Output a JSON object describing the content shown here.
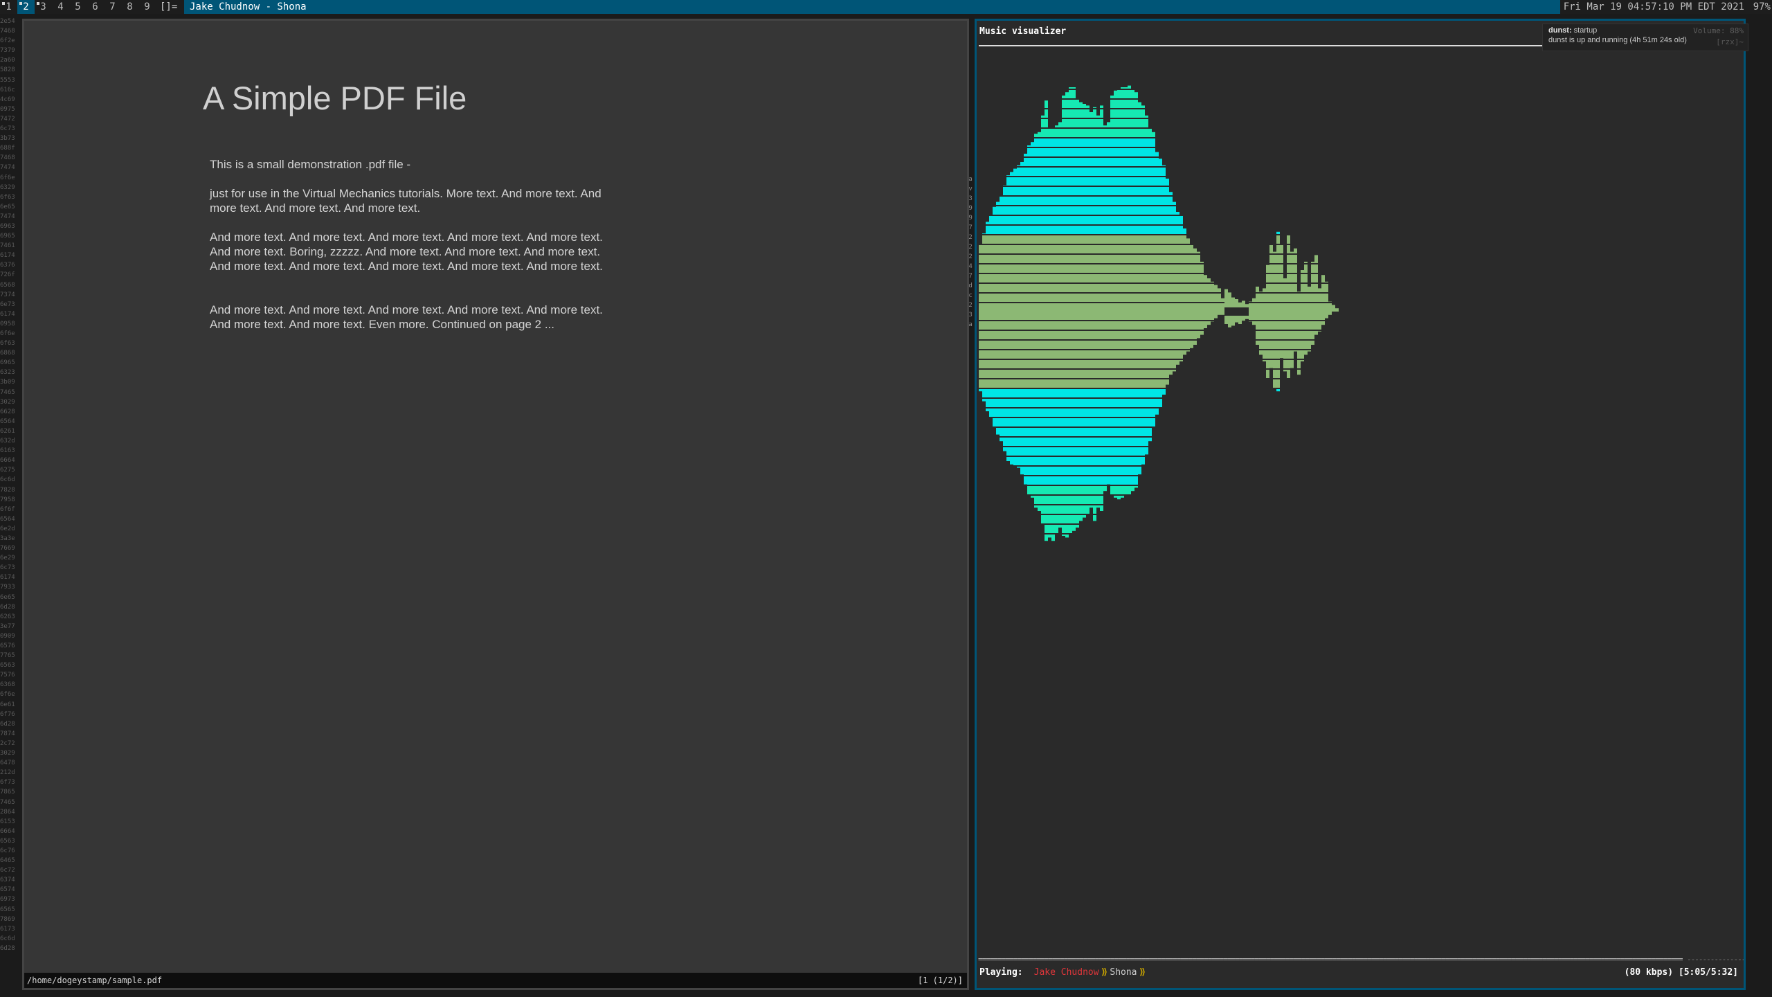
{
  "bar": {
    "tags": [
      "1",
      "2",
      "3",
      "4",
      "5",
      "6",
      "7",
      "8",
      "9"
    ],
    "active_tag": "2",
    "layout_symbol": "[]=",
    "window_title": "Jake Chudnow - Shona",
    "datetime": "Fri Mar 19 04:57:10 PM EDT 2021",
    "battery": "97%"
  },
  "background_terminal": {
    "hex_lines": [
      "2e54",
      "7468",
      "6f2e",
      "7379",
      "2a60",
      "5828",
      "5553",
      "616c",
      "4c69",
      "0975",
      "7472",
      "6c73",
      "3b73",
      "688f",
      "7468",
      "7474",
      "6f6e",
      "6329",
      "6f63",
      "6e65",
      "7474",
      "6963",
      "6965",
      "7461",
      "6174",
      "6376",
      "726f",
      "6568",
      "7374",
      "6e73",
      "6174",
      "0958",
      "6f6e",
      "6f63",
      "6868",
      "6965",
      "6323",
      "3b09",
      "7465",
      "3029",
      "6628",
      "6564",
      "6261",
      "632d",
      "6163",
      "6664",
      "6275",
      "6c6d",
      "7828",
      "7958",
      "6f6f",
      "6564",
      "6e2d",
      "3a3e",
      "7669",
      "6e29",
      "6c73",
      "6174",
      "7933",
      "6e65",
      "6d28",
      "6263",
      "3e77",
      "0909",
      "6576",
      "7765",
      "6563",
      "7576",
      "6368",
      "6f6e",
      "6e61",
      "6f76",
      "6d28",
      "7874",
      "2c72",
      "3029",
      "6478",
      "212d",
      "6f73",
      "7865",
      "7465",
      "2864",
      "6153",
      "6664",
      "6563",
      "6c76",
      "6465",
      "6c72",
      "6374",
      "6574",
      "6973",
      "6565",
      "7869",
      "6173",
      "6c6d",
      "6d28"
    ],
    "mid_glyphs": [
      ":a",
      ":v",
      ":3",
      ":9",
      ":9",
      ":7",
      ":2",
      ":2",
      ":2",
      ":4",
      ":7",
      ":d",
      ":c",
      ":2",
      ":3",
      ":a"
    ]
  },
  "pdf_viewer": {
    "title": "A Simple PDF File",
    "paragraphs": [
      "This is a small demonstration .pdf file -",
      "just for use in the Virtual Mechanics tutorials. More text. And more text. And more text. And more text. And more text.",
      "And more text. And more text. And more text. And more text. And more text. And more text. Boring, zzzzz. And more text. And more text. And more text. And more text. And more text. And more text. And more text. And more text.",
      "And more text. And more text. And more text. And more text. And more text. And more text. And more text. Even more. Continued on page 2 ..."
    ],
    "status_path": "/home/dogeystamp/sample.pdf",
    "status_page": "[1 (1/2)]"
  },
  "visualizer": {
    "title": "Music visualizer",
    "playing_label": "Playing:",
    "artist": "Jake Chudnow",
    "separator": "⟫",
    "track": "Shona",
    "bitrate": "(80 kbps)",
    "time": "[5:05/5:32]",
    "progress_fraction": 0.92,
    "colors": {
      "cyan": "#00e5e5",
      "teal": "#16e9b3",
      "green": "#8cb874",
      "accent_red": "#e0363a",
      "separator": "#c8a400"
    },
    "spectrum_upper": [
      40,
      47,
      54,
      58,
      63,
      66,
      70,
      76,
      82,
      84,
      86,
      88,
      90,
      95,
      100,
      102,
      107,
      108,
      118,
      127,
      110,
      110,
      112,
      114,
      130,
      132,
      135,
      135,
      128,
      126,
      125,
      124,
      120,
      123,
      118,
      124,
      112,
      114,
      130,
      133,
      134,
      135,
      135,
      136,
      134,
      132,
      126,
      124,
      118,
      110,
      108,
      96,
      92,
      88,
      80,
      72,
      66,
      60,
      58,
      50,
      44,
      40,
      38,
      36,
      30,
      22,
      20,
      18,
      16,
      14,
      8,
      -22,
      -18,
      -12,
      -10,
      -6,
      -8,
      -4,
      6,
      8,
      15,
      12,
      14,
      28,
      40,
      36,
      48,
      40,
      20,
      46,
      36,
      38,
      12,
      25,
      30,
      15,
      30,
      34,
      14,
      22,
      18,
      6,
      4,
      2
    ],
    "spectrum_lower": [
      48,
      54,
      60,
      64,
      70,
      74,
      78,
      84,
      90,
      92,
      93,
      94,
      98,
      104,
      110,
      112,
      118,
      120,
      128,
      138,
      136,
      138,
      134,
      130,
      135,
      136,
      134,
      132,
      130,
      126,
      124,
      122,
      118,
      126,
      118,
      120,
      108,
      104,
      110,
      112,
      113,
      112,
      110,
      110,
      108,
      106,
      98,
      92,
      86,
      78,
      70,
      62,
      58,
      50,
      44,
      38,
      36,
      32,
      30,
      26,
      24,
      22,
      20,
      16,
      14,
      10,
      8,
      6,
      4,
      2,
      2,
      -10,
      -14,
      -12,
      -8,
      -10,
      -6,
      -4,
      6,
      8,
      20,
      26,
      30,
      40,
      34,
      46,
      48,
      28,
      36,
      40,
      34,
      24,
      38,
      30,
      26,
      24,
      20,
      14,
      12,
      8,
      4,
      2,
      0
    ]
  }
}
